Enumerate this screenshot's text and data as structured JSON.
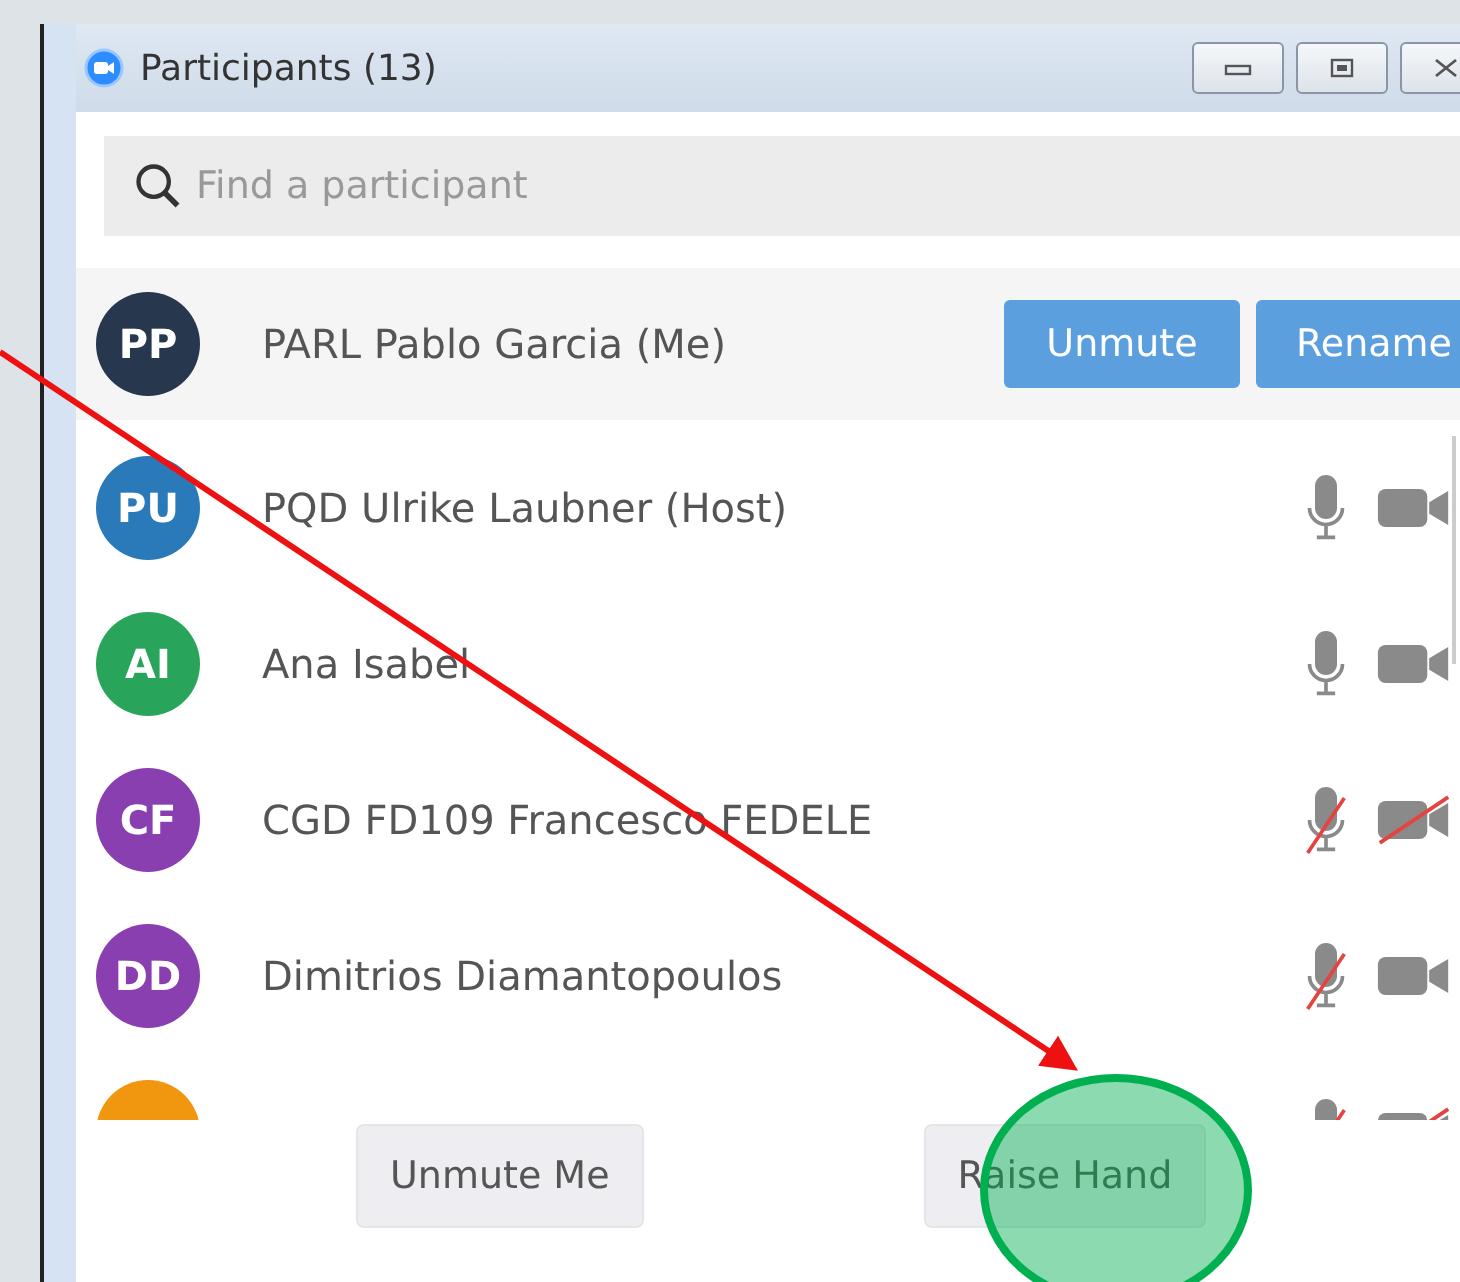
{
  "window": {
    "title": "Participants (13)"
  },
  "search": {
    "placeholder": "Find a participant"
  },
  "me": {
    "initials": "PP",
    "name": "PARL Pablo Garcia (Me)",
    "color": "#27384e",
    "buttons": [
      "Unmute",
      "Rename"
    ]
  },
  "participants": [
    {
      "initials": "PU",
      "name": "PQD Ulrike Laubner (Host)",
      "color": "#2a7ab9",
      "mic_muted": false,
      "video_off": false
    },
    {
      "initials": "AI",
      "name": "Ana Isabel",
      "color": "#28a55a",
      "mic_muted": false,
      "video_off": false
    },
    {
      "initials": "CF",
      "name": "CGD FD109 Francesco FEDELE",
      "color": "#8a3fb0",
      "mic_muted": true,
      "video_off": true
    },
    {
      "initials": "DD",
      "name": "Dimitrios Diamantopoulos",
      "color": "#8a3fb0",
      "mic_muted": true,
      "video_off": false
    },
    {
      "color": "#f0960f",
      "mic_muted": true,
      "video_off": true
    }
  ],
  "footer_buttons": [
    "Unmute Me",
    "Raise Hand"
  ],
  "annotations": [
    {
      "kind": "arrow",
      "color": "#ee1111"
    },
    {
      "kind": "ellipse",
      "color": "#00b050"
    }
  ]
}
